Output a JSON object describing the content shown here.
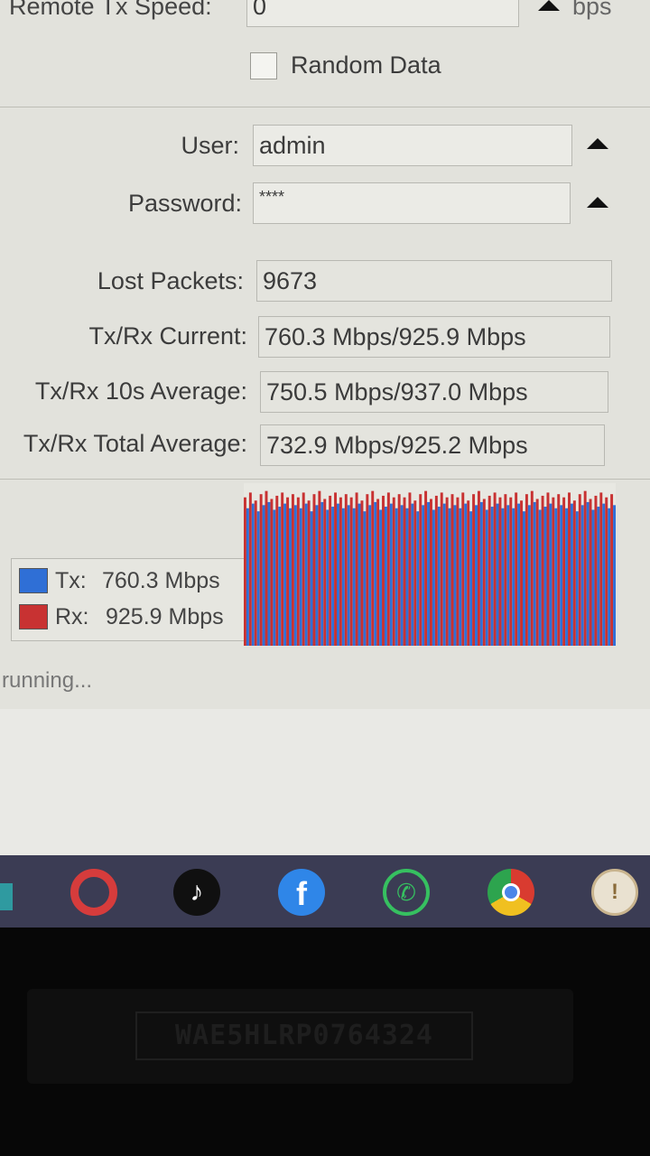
{
  "form": {
    "remote_tx_speed_label": "Remote Tx Speed:",
    "remote_tx_speed_value": "0",
    "remote_tx_speed_unit": "bps",
    "random_data_label": "Random Data",
    "random_data_checked": false,
    "user_label": "User:",
    "user_value": "admin",
    "password_label": "Password:",
    "password_value": "****"
  },
  "stats": {
    "lost_packets_label": "Lost Packets:",
    "lost_packets_value": "9673",
    "current_label": "Tx/Rx Current:",
    "current_value": "760.3 Mbps/925.9 Mbps",
    "avg10_label": "Tx/Rx 10s Average:",
    "avg10_value": "750.5 Mbps/937.0 Mbps",
    "total_label": "Tx/Rx Total Average:",
    "total_value": "732.9 Mbps/925.2 Mbps"
  },
  "legend": {
    "tx_label": "Tx:",
    "tx_value": "760.3 Mbps",
    "rx_label": "Rx:",
    "rx_value": "925.9 Mbps"
  },
  "colors": {
    "tx": "#2f6fd6",
    "rx": "#c83232"
  },
  "graph": {
    "ymax": 1000,
    "bars": 70
  },
  "status": "running...",
  "taskbar": {
    "icons": [
      "opera-icon",
      "tiktok-icon",
      "facebook-icon",
      "whatsapp-icon",
      "chrome-icon",
      "app-icon"
    ]
  },
  "sticker_text": "WAE5HLRP0764324"
}
